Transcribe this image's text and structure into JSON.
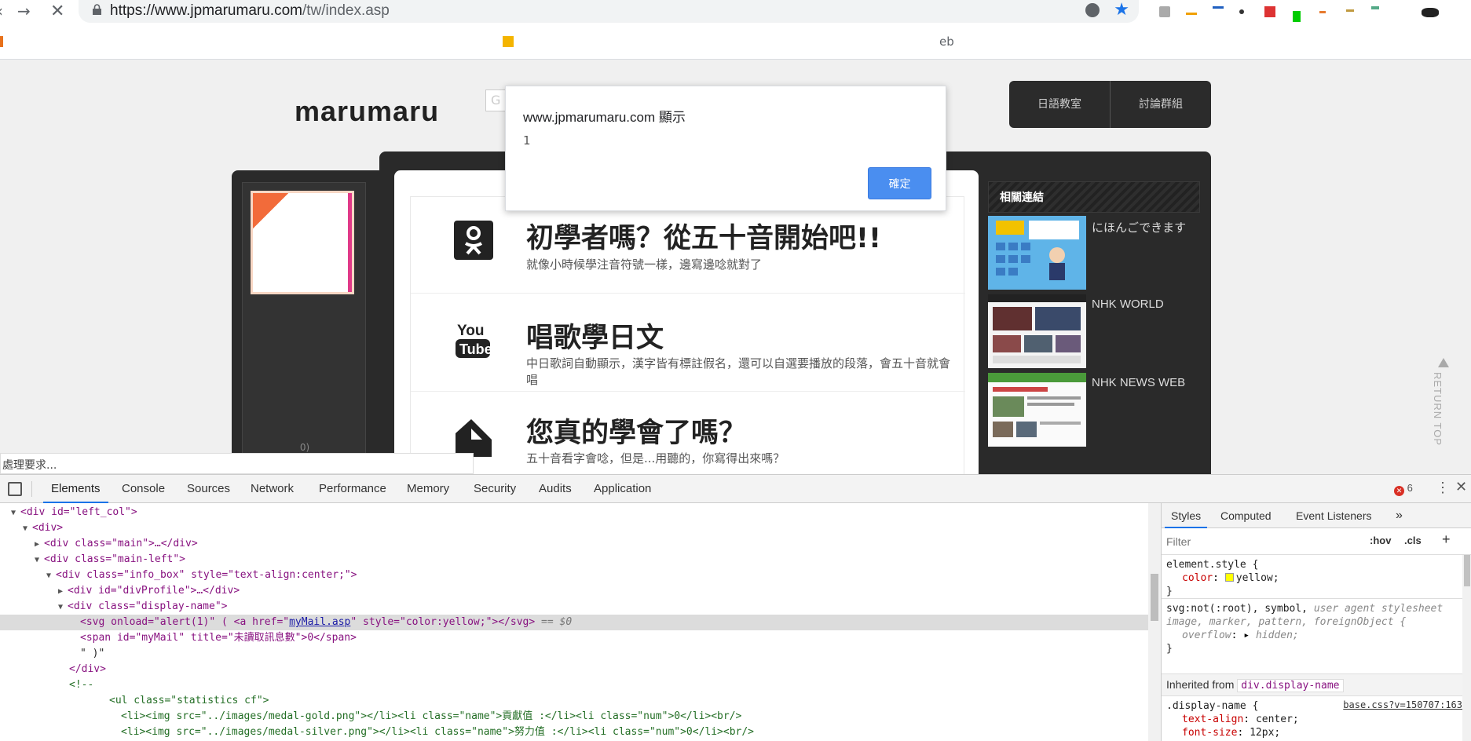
{
  "browser": {
    "url_host": "https://www.jpmarumaru.com",
    "url_path": "/tw/index.asp",
    "bookmark_fragment": "eb"
  },
  "page": {
    "logo": "marumaru",
    "search_placeholder": "G",
    "top_menu": [
      "日語教室",
      "討論群組"
    ],
    "features": [
      {
        "icon": "odnoklassniki-icon",
        "title": "初學者嗎？從五十音開始吧!!",
        "desc": "就像小時候學注音符號一樣，邊寫邊唸就對了"
      },
      {
        "icon": "youtube-icon",
        "title": "唱歌學日文",
        "desc": "中日歌詞自動顯示，漢字皆有標註假名，還可以自選要播放的段落，會五十音就會唱"
      },
      {
        "icon": "pencil-box-icon",
        "title": "您真的學會了嗎？",
        "desc": "五十音看字會唸，但是...用聽的，你寫得出來嗎？"
      }
    ],
    "display_name": "0)",
    "sidebar_title": "相關連結",
    "links": [
      "にほんごできます",
      "NHK WORLD",
      "NHK NEWS WEB"
    ],
    "return_top": "RETURN TOP",
    "status_text": "處理要求..."
  },
  "alert": {
    "title": "www.jpmarumaru.com 顯示",
    "message": "1",
    "ok_label": "確定"
  },
  "devtools": {
    "tabs": [
      "Elements",
      "Console",
      "Sources",
      "Network",
      "Performance",
      "Memory",
      "Security",
      "Audits",
      "Application"
    ],
    "error_count": "6",
    "dom": {
      "l1_tag": "<div id=\"left_col\">",
      "l2_tag": "<div>",
      "l3_tag": "<div class=\"main\">…</div>",
      "l4_tag": "<div class=\"main-left\">",
      "l5_tag": "<div class=\"info_box\" style=\"text-align:center;\">",
      "l6_tag": "<div id=\"divProfile\">…</div>",
      "l7_tag": "<div class=\"display-name\">",
      "l8_a": "<svg onload=\"alert(1)\" ( <a href=\"",
      "l8_link": "myMail.asp",
      "l8_b": "\" style=\"color:yellow;\"></svg>",
      "l8_marker": " == $0",
      "l9_tag": "<span id=\"myMail\" title=\"未讀取訊息數\">0</span>",
      "l10_text": "\" )\"",
      "l11_tag": "</div>",
      "l12_comment": "<!--",
      "l13_tag": "<ul class=\"statistics cf\">",
      "l14_text": "<li><img src=\"../images/medal-gold.png\"></li><li class=\"name\">貢獻值 :</li><li class=\"num\">0</li><br/>",
      "l15_text": "<li><img src=\"../images/medal-silver.png\"></li><li class=\"name\">努力值 :</li><li class=\"num\">0</li><br/>"
    },
    "styles": {
      "tabs": [
        "Styles",
        "Computed",
        "Event Listeners"
      ],
      "more": "»",
      "filter_placeholder": "Filter",
      "hov": ":hov",
      "cls": ".cls",
      "plus": "+",
      "r1_selector": "element.style {",
      "r1_prop": "color",
      "r1_val": "yellow;",
      "close": "}",
      "r2_selector_a": "svg:not(:root), symbol,",
      "r2_selector_b": "user agent stylesheet",
      "r2_selector_c": "image, marker, pattern, foreignObject {",
      "r2_prop": "overflow",
      "r2_val": "hidden;",
      "inherited_label": "Inherited from",
      "inherited_node": "div.display-name",
      "r3_selector": ".display-name {",
      "r3_source": "base.css?v=150707:163",
      "r3_prop1": "text-align",
      "r3_val1": "center;",
      "r3_prop2": "font-size",
      "r3_val2": "12px;"
    }
  },
  "colors": {
    "accent": "#1a73e8",
    "alert_button": "#4a8ef0",
    "yellow_swatch": "#ffff00"
  }
}
